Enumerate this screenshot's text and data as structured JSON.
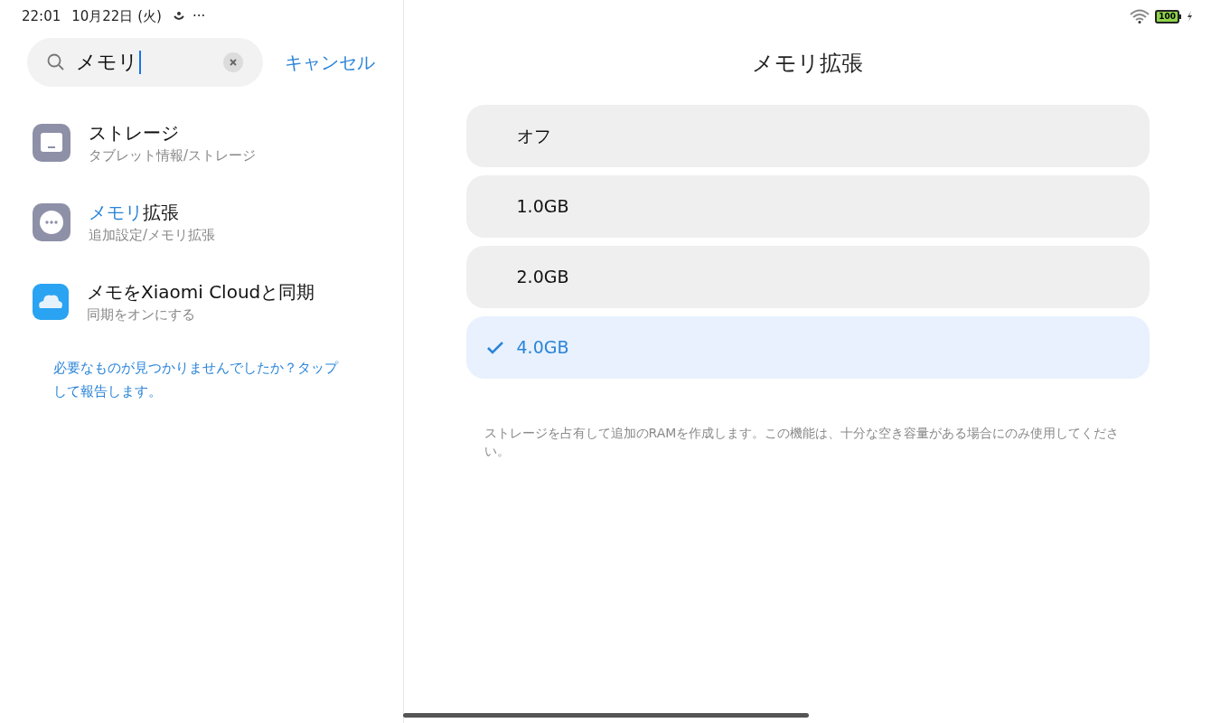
{
  "status_bar": {
    "time": "22:01",
    "date": "10月22日 (火)",
    "more": "···",
    "battery": "100"
  },
  "search": {
    "value": "メモリ",
    "cancel": "キャンセル"
  },
  "results": [
    {
      "kind": "storage",
      "title": [
        {
          "text": "ストレージ",
          "highlighted": false
        }
      ],
      "path": "タブレット情報/ストレージ"
    },
    {
      "kind": "more",
      "title": [
        {
          "text": "メモリ",
          "highlighted": true
        },
        {
          "text": "拡張",
          "highlighted": false
        }
      ],
      "path": "追加設定/メモリ拡張"
    },
    {
      "kind": "cloud",
      "title": [
        {
          "text": "メモをXiaomi Cloudと同期",
          "highlighted": false
        }
      ],
      "path": "同期をオンにする"
    }
  ],
  "feedback_link": "必要なものが見つかりませんでしたか？タップして報告します。",
  "detail": {
    "title": "メモリ拡張",
    "options": [
      {
        "label": "オフ",
        "selected": false
      },
      {
        "label": "1.0GB",
        "selected": false
      },
      {
        "label": "2.0GB",
        "selected": false
      },
      {
        "label": "4.0GB",
        "selected": true
      }
    ],
    "description": "ストレージを占有して追加のRAMを作成します。この機能は、十分な空き容量がある場合にのみ使用してください。"
  }
}
